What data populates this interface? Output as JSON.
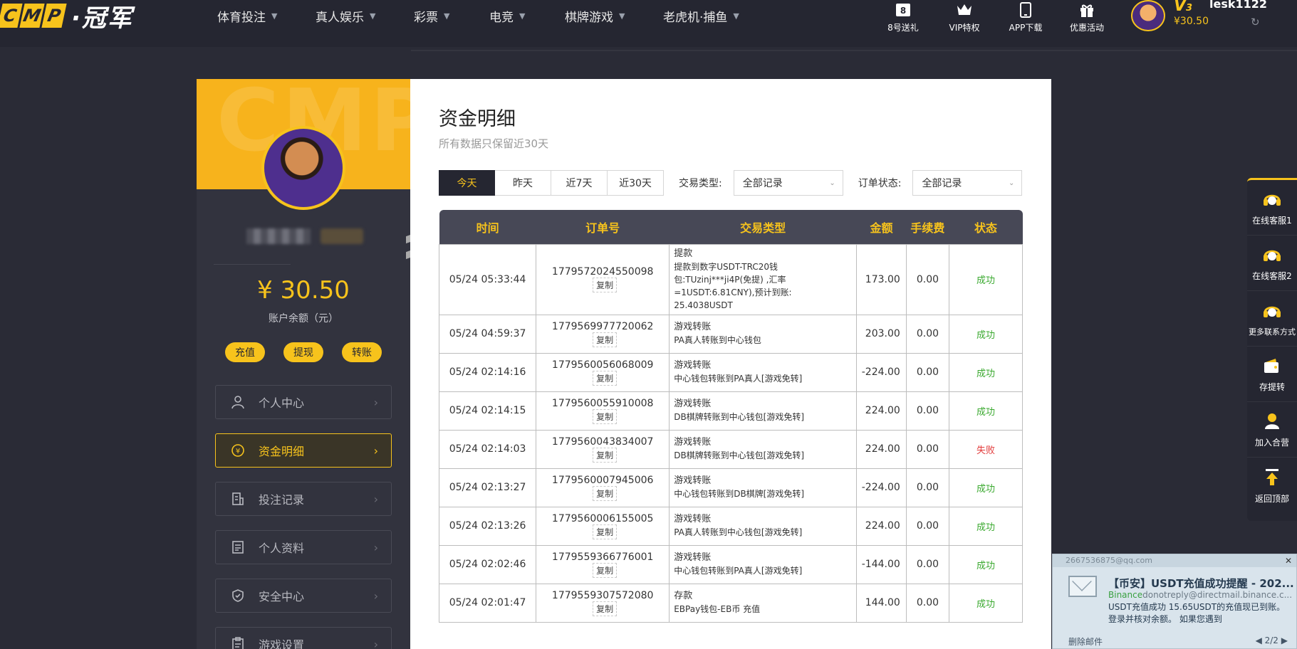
{
  "header": {
    "logo_letters": [
      "C",
      "M",
      "P"
    ],
    "logo_name": "·冠军",
    "nav": [
      {
        "label": "体育投注"
      },
      {
        "label": "真人娱乐"
      },
      {
        "label": "彩票"
      },
      {
        "label": "电竞"
      },
      {
        "label": "棋牌游戏"
      },
      {
        "label": "老虎机·捕鱼"
      }
    ],
    "icons": [
      {
        "label": "8号送礼",
        "icon": "gift-ticket-icon"
      },
      {
        "label": "VIP特权",
        "icon": "crown-icon"
      },
      {
        "label": "APP下载",
        "icon": "tablet-icon"
      },
      {
        "label": "优惠活动",
        "icon": "gift-icon"
      }
    ],
    "user": {
      "vip": "V",
      "vip_level": "3",
      "username": "lesk1122",
      "balance": "¥30.50"
    }
  },
  "sidebar": {
    "watermark": "CMP",
    "balance": "¥ 30.50",
    "balance_label": "账户余额（元）",
    "actions": [
      "充值",
      "提现",
      "转账"
    ],
    "menu": [
      {
        "label": "个人中心",
        "icon": "user-icon",
        "active": false
      },
      {
        "label": "资金明细",
        "icon": "yuan-coin-icon",
        "active": true
      },
      {
        "label": "投注记录",
        "icon": "bet-record-icon",
        "active": false
      },
      {
        "label": "个人资料",
        "icon": "profile-icon",
        "active": false
      },
      {
        "label": "安全中心",
        "icon": "shield-icon",
        "active": false
      },
      {
        "label": "游戏设置",
        "icon": "settings-doc-icon",
        "active": false
      }
    ]
  },
  "main": {
    "title": "资金明细",
    "subtitle": "所有数据只保留近30天",
    "range_tabs": [
      "今天",
      "昨天",
      "近7天",
      "近30天"
    ],
    "filter_type_label": "交易类型:",
    "filter_type_value": "全部记录",
    "filter_status_label": "订单状态:",
    "filter_status_value": "全部记录",
    "columns": [
      "时间",
      "订单号",
      "交易类型",
      "金额",
      "手续费",
      "状态"
    ],
    "copy_label": "复制",
    "rows": [
      {
        "time": "05/24 05:33:44",
        "order": "1779572024550098",
        "type": "提款",
        "detail": "提款到数字USDT-TRC20钱包:TUzinj***ji4P(免提) ,汇率=1USDT:6.81CNY),预计到账: 25.4038USDT",
        "amount": "173.00",
        "fee": "0.00",
        "status": "成功",
        "ok": true
      },
      {
        "time": "05/24 04:59:37",
        "order": "1779569977720062",
        "type": "游戏转账",
        "detail": "PA真人转账到中心钱包",
        "amount": "203.00",
        "fee": "0.00",
        "status": "成功",
        "ok": true
      },
      {
        "time": "05/24 02:14:16",
        "order": "1779560056068009",
        "type": "游戏转账",
        "detail": "中心钱包转账到PA真人[游戏免转]",
        "amount": "-224.00",
        "fee": "0.00",
        "status": "成功",
        "ok": true
      },
      {
        "time": "05/24 02:14:15",
        "order": "1779560055910008",
        "type": "游戏转账",
        "detail": "DB棋牌转账到中心钱包[游戏免转]",
        "amount": "224.00",
        "fee": "0.00",
        "status": "成功",
        "ok": true
      },
      {
        "time": "05/24 02:14:03",
        "order": "1779560043834007",
        "type": "游戏转账",
        "detail": "DB棋牌转账到中心钱包[游戏免转]",
        "amount": "224.00",
        "fee": "0.00",
        "status": "失败",
        "ok": false
      },
      {
        "time": "05/24 02:13:27",
        "order": "1779560007945006",
        "type": "游戏转账",
        "detail": "中心钱包转账到DB棋牌[游戏免转]",
        "amount": "-224.00",
        "fee": "0.00",
        "status": "成功",
        "ok": true
      },
      {
        "time": "05/24 02:13:26",
        "order": "1779560006155005",
        "type": "游戏转账",
        "detail": "PA真人转账到中心钱包[游戏免转]",
        "amount": "224.00",
        "fee": "0.00",
        "status": "成功",
        "ok": true
      },
      {
        "time": "05/24 02:02:46",
        "order": "1779559366776001",
        "type": "游戏转账",
        "detail": "中心钱包转账到PA真人[游戏免转]",
        "amount": "-144.00",
        "fee": "0.00",
        "status": "成功",
        "ok": true
      },
      {
        "time": "05/24 02:01:47",
        "order": "1779559307572080",
        "type": "存款",
        "detail": "EBPay钱包-EB币 充值",
        "amount": "144.00",
        "fee": "0.00",
        "status": "成功",
        "ok": true
      }
    ]
  },
  "rightbar": [
    {
      "label": "在线客服1",
      "icon": "headset-icon"
    },
    {
      "label": "在线客服2",
      "icon": "headset-icon"
    },
    {
      "label": "更多联系方式",
      "icon": "headset-icon"
    },
    {
      "label": "存提转",
      "icon": "wallet-icon"
    },
    {
      "label": "加入合营",
      "icon": "partner-icon"
    },
    {
      "label": "返回顶部",
      "icon": "back-to-top-icon"
    }
  ],
  "notification": {
    "account": "2667536875@qq.com",
    "title": "【币安】USDT充值成功提醒 - 202...",
    "brand": "Binance",
    "sender": "donotreply@directmail.binance.c...",
    "body": "USDT充值成功     15.65USDT的充值现已到账。 登录并核对余额。 如果您遇到",
    "delete": "删除邮件",
    "page": "2/2"
  },
  "colors": {
    "accent": "#f7c31c",
    "dark": "#252631",
    "success": "#3aa92f",
    "fail": "#e23b3b"
  }
}
